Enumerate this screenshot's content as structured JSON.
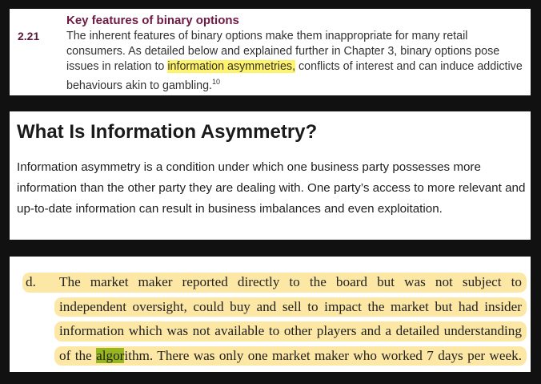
{
  "excerpt": {
    "section_number": "2.21",
    "heading": "Key features of binary options",
    "text_before": "The inherent features of binary options make them inappropriate for many retail consumers. As detailed below and explained further in Chapter 3, binary options pose issues in relation to ",
    "highlighted": "information asymmetries,",
    "text_after": " conflicts of interest and can induce addictive behaviours akin to gambling.",
    "footnote": "10",
    "highlight_color": "#fff36a"
  },
  "definition": {
    "title": "What Is Information Asymmetry?",
    "body": "Information asymmetry is a condition under which one business party possesses more information than the other party they are dealing with. One party’s access to more relevant and up-to-date information can result in business imbalances and even exploitation."
  },
  "legal": {
    "label": "d.",
    "line1": "The market maker reported directly to the board but was not subject to",
    "line2": "independent oversight, could buy and sell to impact the market but had insider",
    "line3": "information which was not available to other players and a detailed understanding",
    "line4_before": "of the ",
    "line4_highlight": "algor",
    "line4_after": "ithm. There was only one market maker who worked 7 days per week.",
    "band_color": "#fce7a5",
    "word_highlight_color": "#98b61d"
  }
}
